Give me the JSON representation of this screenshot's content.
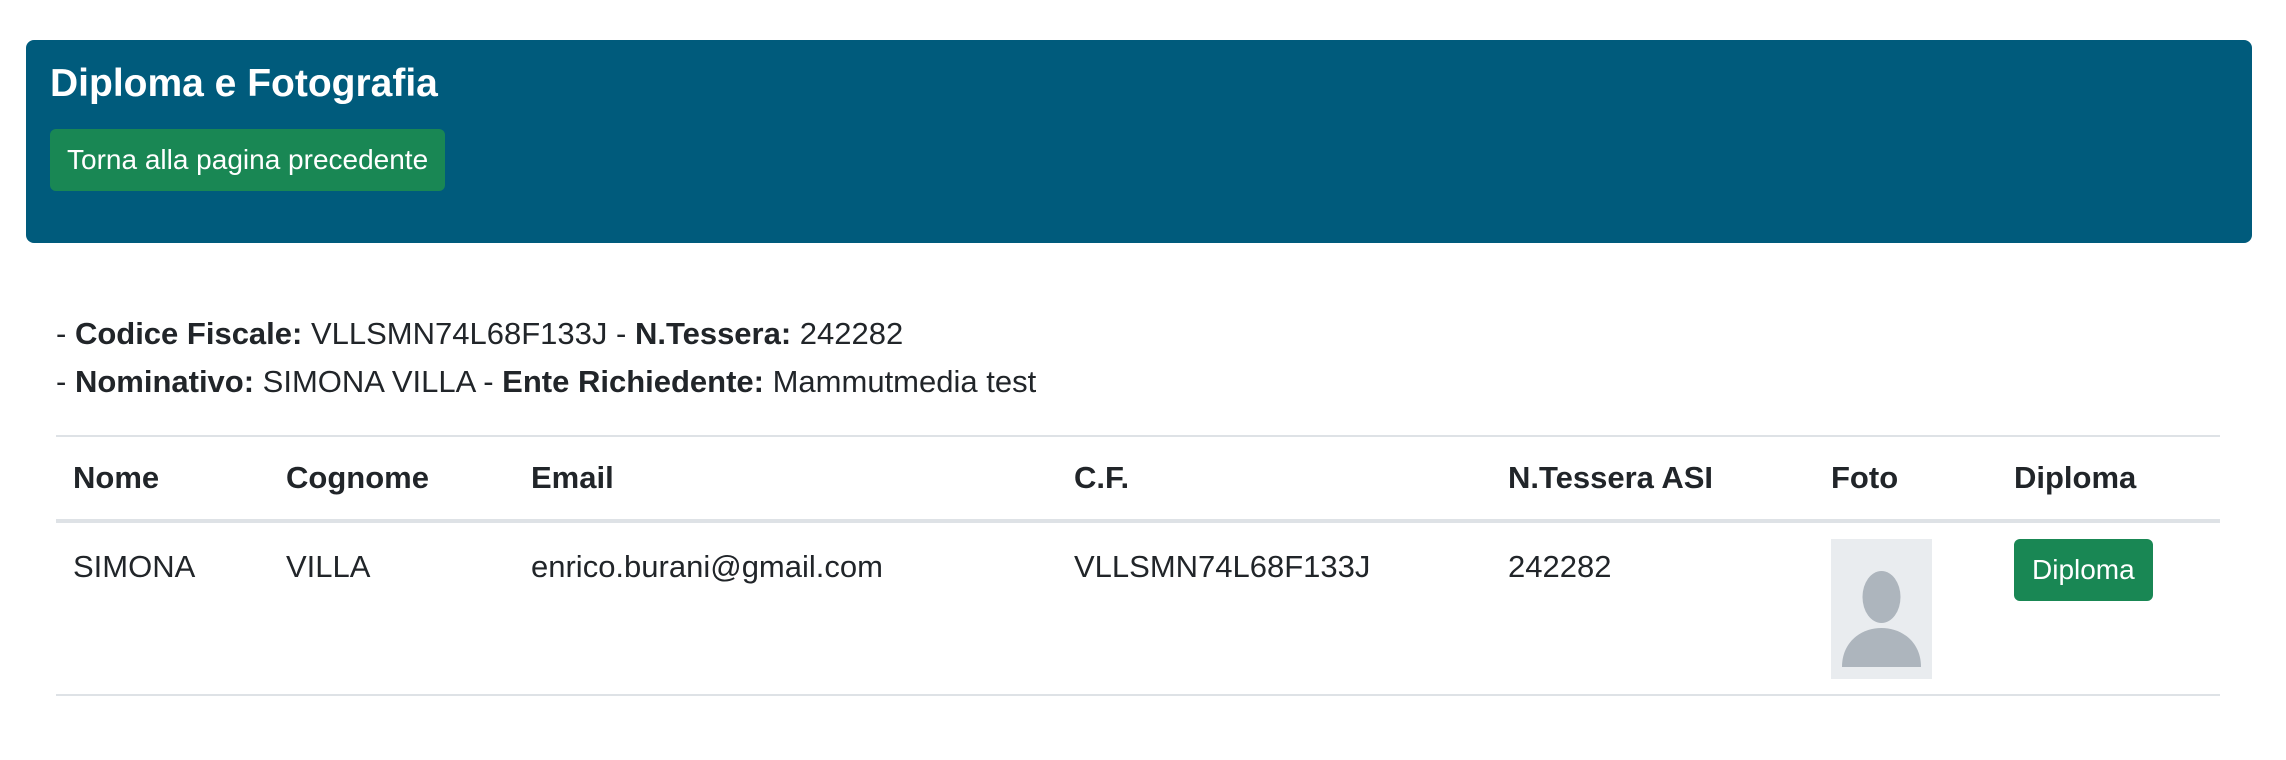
{
  "header": {
    "title": "Diploma e Fotografia",
    "back_button_label": "Torna alla pagina precedente"
  },
  "info": {
    "line1": {
      "prefix": "- ",
      "codice_fiscale_label": "Codice Fiscale:",
      "codice_fiscale_value": " VLLSMN74L68F133J",
      "separator": " - ",
      "tessera_label": "N.Tessera:",
      "tessera_value": " 242282"
    },
    "line2": {
      "prefix": "- ",
      "nominativo_label": "Nominativo:",
      "nominativo_value": " SIMONA VILLA",
      "separator": " - ",
      "ente_label": "Ente Richiedente:",
      "ente_value": " Mammutmedia test"
    }
  },
  "table": {
    "headers": [
      "Nome",
      "Cognome",
      "Email",
      "C.F.",
      "N.Tessera ASI",
      "Foto",
      "Diploma"
    ],
    "rows": [
      {
        "nome": "SIMONA",
        "cognome": "VILLA",
        "email": "enrico.burani@gmail.com",
        "cf": "VLLSMN74L68F133J",
        "tessera": "242282",
        "foto_icon": "user-avatar-placeholder-icon",
        "diploma_button_label": "Diploma"
      }
    ]
  },
  "colors": {
    "header_background": "#005b7c",
    "button_green": "#198754",
    "avatar_background": "#e9ecef",
    "avatar_silhouette": "#adb5bd"
  }
}
